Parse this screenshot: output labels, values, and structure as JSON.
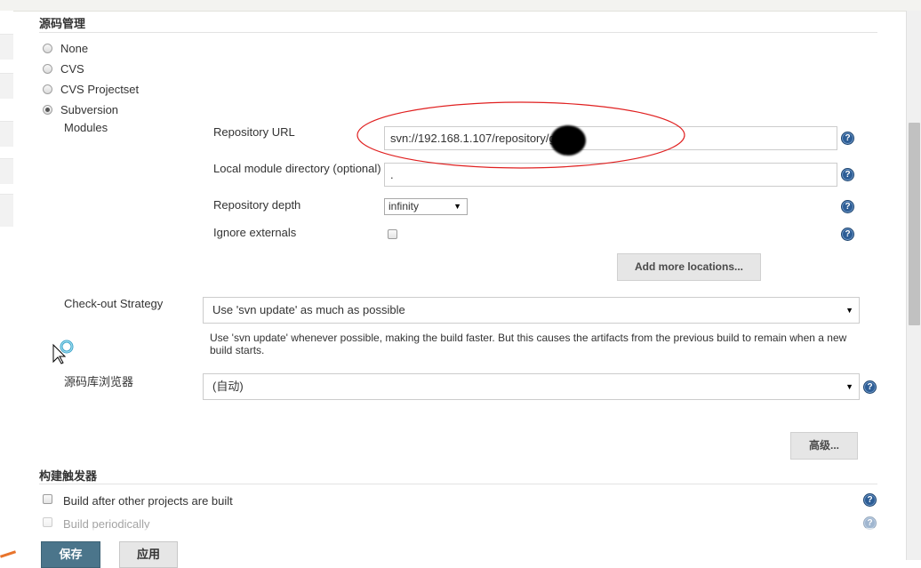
{
  "scm": {
    "section_title": "源码管理",
    "options": [
      {
        "label": "None",
        "checked": false
      },
      {
        "label": "CVS",
        "checked": false
      },
      {
        "label": "CVS Projectset",
        "checked": false
      },
      {
        "label": "Subversion",
        "checked": true
      }
    ],
    "modules_label": "Modules",
    "repo_url_label": "Repository URL",
    "repo_url_value": "svn://192.168.1.107/repository/g",
    "local_dir_label": "Local module directory (optional)",
    "local_dir_value": ".",
    "depth_label": "Repository depth",
    "depth_value": "infinity",
    "ignore_externals_label": "Ignore externals",
    "ignore_externals_checked": false,
    "add_more_label": "Add more locations...",
    "checkout_label": "Check-out Strategy",
    "checkout_value": "Use 'svn update' as much as possible",
    "checkout_desc": "Use 'svn update' whenever possible, making the build faster. But this causes the artifacts from the previous build to remain when a new build starts.",
    "browser_label": "源码库浏览器",
    "browser_value": "(自动)",
    "advanced_label": "高级..."
  },
  "triggers": {
    "section_title": "构建触发器",
    "items": [
      {
        "label": "Build after other projects are built",
        "checked": false
      },
      {
        "label": "Build periodically",
        "checked": false
      }
    ]
  },
  "footer": {
    "save_label": "保存",
    "apply_label": "应用"
  },
  "icons": {
    "help": "help-icon",
    "dropdown": "chevron-down-icon",
    "cursor": "busy-cursor-icon"
  },
  "colors": {
    "save_button": "#4b758b",
    "help_icon": "#2e5e96",
    "annotation_ellipse": "#e02020"
  }
}
